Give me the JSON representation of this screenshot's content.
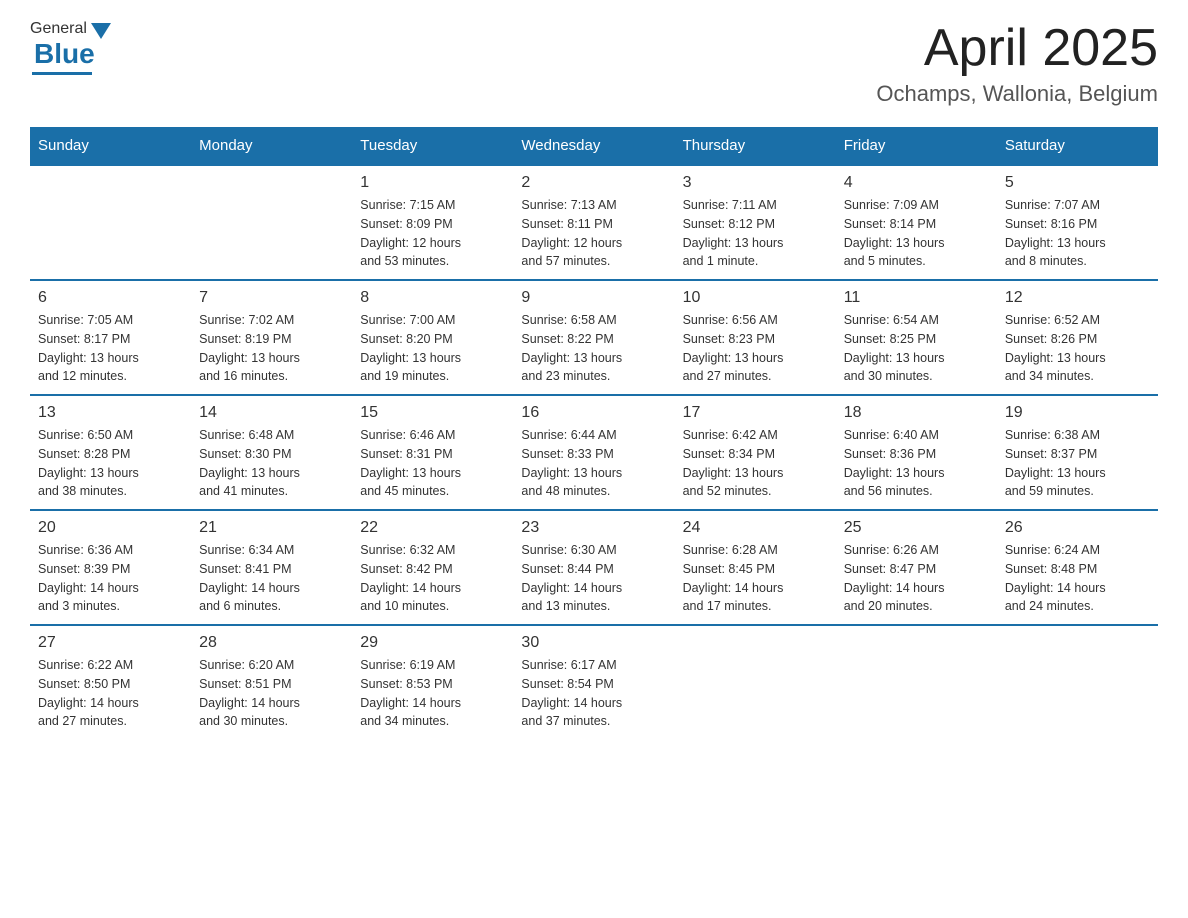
{
  "header": {
    "logo": {
      "general": "General",
      "blue": "Blue"
    },
    "title": "April 2025",
    "subtitle": "Ochamps, Wallonia, Belgium"
  },
  "weekdays": [
    "Sunday",
    "Monday",
    "Tuesday",
    "Wednesday",
    "Thursday",
    "Friday",
    "Saturday"
  ],
  "weeks": [
    [
      {
        "day": "",
        "info": ""
      },
      {
        "day": "",
        "info": ""
      },
      {
        "day": "1",
        "info": "Sunrise: 7:15 AM\nSunset: 8:09 PM\nDaylight: 12 hours\nand 53 minutes."
      },
      {
        "day": "2",
        "info": "Sunrise: 7:13 AM\nSunset: 8:11 PM\nDaylight: 12 hours\nand 57 minutes."
      },
      {
        "day": "3",
        "info": "Sunrise: 7:11 AM\nSunset: 8:12 PM\nDaylight: 13 hours\nand 1 minute."
      },
      {
        "day": "4",
        "info": "Sunrise: 7:09 AM\nSunset: 8:14 PM\nDaylight: 13 hours\nand 5 minutes."
      },
      {
        "day": "5",
        "info": "Sunrise: 7:07 AM\nSunset: 8:16 PM\nDaylight: 13 hours\nand 8 minutes."
      }
    ],
    [
      {
        "day": "6",
        "info": "Sunrise: 7:05 AM\nSunset: 8:17 PM\nDaylight: 13 hours\nand 12 minutes."
      },
      {
        "day": "7",
        "info": "Sunrise: 7:02 AM\nSunset: 8:19 PM\nDaylight: 13 hours\nand 16 minutes."
      },
      {
        "day": "8",
        "info": "Sunrise: 7:00 AM\nSunset: 8:20 PM\nDaylight: 13 hours\nand 19 minutes."
      },
      {
        "day": "9",
        "info": "Sunrise: 6:58 AM\nSunset: 8:22 PM\nDaylight: 13 hours\nand 23 minutes."
      },
      {
        "day": "10",
        "info": "Sunrise: 6:56 AM\nSunset: 8:23 PM\nDaylight: 13 hours\nand 27 minutes."
      },
      {
        "day": "11",
        "info": "Sunrise: 6:54 AM\nSunset: 8:25 PM\nDaylight: 13 hours\nand 30 minutes."
      },
      {
        "day": "12",
        "info": "Sunrise: 6:52 AM\nSunset: 8:26 PM\nDaylight: 13 hours\nand 34 minutes."
      }
    ],
    [
      {
        "day": "13",
        "info": "Sunrise: 6:50 AM\nSunset: 8:28 PM\nDaylight: 13 hours\nand 38 minutes."
      },
      {
        "day": "14",
        "info": "Sunrise: 6:48 AM\nSunset: 8:30 PM\nDaylight: 13 hours\nand 41 minutes."
      },
      {
        "day": "15",
        "info": "Sunrise: 6:46 AM\nSunset: 8:31 PM\nDaylight: 13 hours\nand 45 minutes."
      },
      {
        "day": "16",
        "info": "Sunrise: 6:44 AM\nSunset: 8:33 PM\nDaylight: 13 hours\nand 48 minutes."
      },
      {
        "day": "17",
        "info": "Sunrise: 6:42 AM\nSunset: 8:34 PM\nDaylight: 13 hours\nand 52 minutes."
      },
      {
        "day": "18",
        "info": "Sunrise: 6:40 AM\nSunset: 8:36 PM\nDaylight: 13 hours\nand 56 minutes."
      },
      {
        "day": "19",
        "info": "Sunrise: 6:38 AM\nSunset: 8:37 PM\nDaylight: 13 hours\nand 59 minutes."
      }
    ],
    [
      {
        "day": "20",
        "info": "Sunrise: 6:36 AM\nSunset: 8:39 PM\nDaylight: 14 hours\nand 3 minutes."
      },
      {
        "day": "21",
        "info": "Sunrise: 6:34 AM\nSunset: 8:41 PM\nDaylight: 14 hours\nand 6 minutes."
      },
      {
        "day": "22",
        "info": "Sunrise: 6:32 AM\nSunset: 8:42 PM\nDaylight: 14 hours\nand 10 minutes."
      },
      {
        "day": "23",
        "info": "Sunrise: 6:30 AM\nSunset: 8:44 PM\nDaylight: 14 hours\nand 13 minutes."
      },
      {
        "day": "24",
        "info": "Sunrise: 6:28 AM\nSunset: 8:45 PM\nDaylight: 14 hours\nand 17 minutes."
      },
      {
        "day": "25",
        "info": "Sunrise: 6:26 AM\nSunset: 8:47 PM\nDaylight: 14 hours\nand 20 minutes."
      },
      {
        "day": "26",
        "info": "Sunrise: 6:24 AM\nSunset: 8:48 PM\nDaylight: 14 hours\nand 24 minutes."
      }
    ],
    [
      {
        "day": "27",
        "info": "Sunrise: 6:22 AM\nSunset: 8:50 PM\nDaylight: 14 hours\nand 27 minutes."
      },
      {
        "day": "28",
        "info": "Sunrise: 6:20 AM\nSunset: 8:51 PM\nDaylight: 14 hours\nand 30 minutes."
      },
      {
        "day": "29",
        "info": "Sunrise: 6:19 AM\nSunset: 8:53 PM\nDaylight: 14 hours\nand 34 minutes."
      },
      {
        "day": "30",
        "info": "Sunrise: 6:17 AM\nSunset: 8:54 PM\nDaylight: 14 hours\nand 37 minutes."
      },
      {
        "day": "",
        "info": ""
      },
      {
        "day": "",
        "info": ""
      },
      {
        "day": "",
        "info": ""
      }
    ]
  ]
}
